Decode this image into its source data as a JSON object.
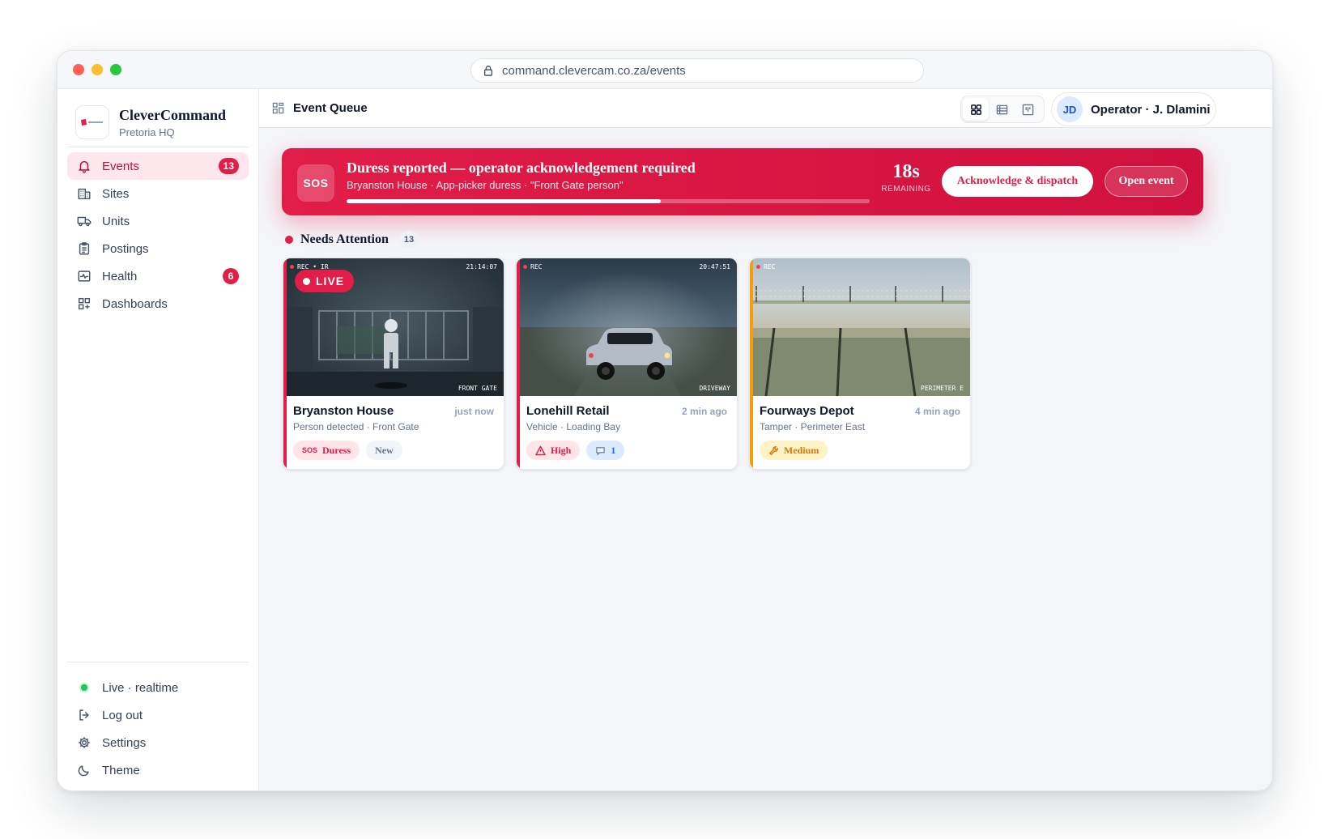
{
  "browser": {
    "url": "command.clevercam.co.za/events"
  },
  "brand": {
    "name": "CleverCommand",
    "site": "Pretoria HQ"
  },
  "nav": {
    "items": [
      {
        "label": "Events",
        "badge": "13",
        "icon": "bell-icon",
        "active": true
      },
      {
        "label": "Sites",
        "icon": "building-icon"
      },
      {
        "label": "Units",
        "icon": "truck-icon"
      },
      {
        "label": "Postings",
        "icon": "clipboard-icon"
      },
      {
        "label": "Health",
        "badge": "6",
        "icon": "pulse-icon"
      },
      {
        "label": "Dashboards",
        "icon": "dashboard-grid-icon"
      }
    ],
    "bottom": [
      {
        "label": "Live · realtime"
      },
      {
        "label": "Log out",
        "icon": "logout-icon"
      },
      {
        "label": "Settings",
        "icon": "gear-icon"
      },
      {
        "label": "Theme",
        "icon": "moon-icon"
      }
    ]
  },
  "topbar": {
    "title": "Event Queue",
    "operator_initials": "JD",
    "operator_name": "Operator · J. Dlamini"
  },
  "alert": {
    "icon_label": "SOS",
    "title": "Duress reported — operator acknowledgement required",
    "subtitle": "Bryanston House · App-picker duress · \"Front Gate person\"",
    "progress": 0.6,
    "countdown": "18s",
    "countdown_label": "REMAINING",
    "ack_label": "Acknowledge & dispatch",
    "open_label": "Open event"
  },
  "section": {
    "title": "Needs Attention",
    "count": "13"
  },
  "cards": [
    {
      "title": "Bryanston House",
      "time": "just now",
      "subtitle": "Person detected · Front Gate",
      "rec": "REC • IR",
      "cam_time": "21:14:07",
      "cam_label": "FRONT GATE",
      "live": "LIVE",
      "stripe": "#e11d48",
      "chips": [
        {
          "icon_text": "SOS",
          "label": "Duress"
        },
        {
          "label": "New"
        }
      ]
    },
    {
      "title": "Lonehill Retail",
      "time": "2 min ago",
      "subtitle": "Vehicle · Loading Bay",
      "rec": "REC",
      "cam_time": "20:47:51",
      "cam_label": "DRIVEWAY",
      "stripe": "#e11d48",
      "chips": [
        {
          "label": "High",
          "icon": "warning-icon"
        },
        {
          "label": "1",
          "icon": "comment-icon"
        }
      ]
    },
    {
      "title": "Fourways Depot",
      "time": "4 min ago",
      "subtitle": "Tamper · Perimeter East",
      "rec": "REC",
      "cam_label": "PERIMETER E",
      "stripe": "#f59e0b",
      "chips": [
        {
          "label": "Medium",
          "icon": "wrench-icon"
        }
      ]
    }
  ]
}
